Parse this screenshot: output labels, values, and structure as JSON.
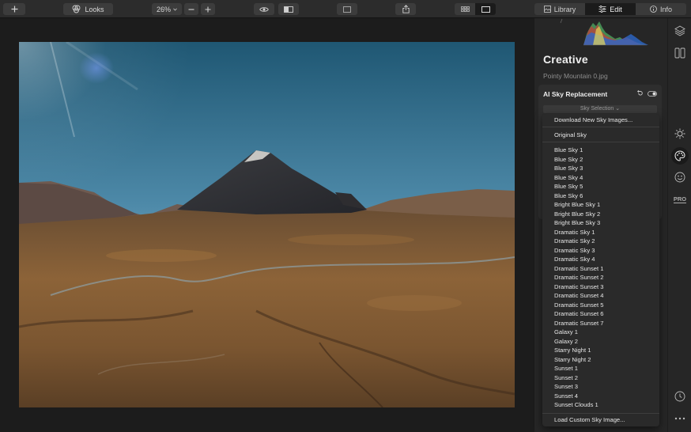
{
  "toolbar": {
    "looks_label": "Looks",
    "zoom_value": "26%",
    "tabs": [
      {
        "label": "Library",
        "active": false
      },
      {
        "label": "Edit",
        "active": true
      },
      {
        "label": "Info",
        "active": false
      }
    ]
  },
  "panel": {
    "title": "Creative",
    "filename": "Pointy Mountain 0.jpg",
    "filter_name": "AI Sky Replacement",
    "sky_selection_label": "Sky Selection"
  },
  "dropdown": {
    "download_label": "Download New Sky Images...",
    "original_label": "Original Sky",
    "skies": [
      "Blue Sky 1",
      "Blue Sky 2",
      "Blue Sky 3",
      "Blue Sky 4",
      "Blue Sky 5",
      "Blue Sky 6",
      "Bright Blue Sky 1",
      "Bright Blue Sky 2",
      "Bright Blue Sky 3",
      "Dramatic Sky 1",
      "Dramatic Sky 2",
      "Dramatic Sky 3",
      "Dramatic Sky 4",
      "Dramatic Sunset 1",
      "Dramatic Sunset 2",
      "Dramatic Sunset 3",
      "Dramatic Sunset 4",
      "Dramatic Sunset 5",
      "Dramatic Sunset 6",
      "Dramatic Sunset 7",
      "Galaxy 1",
      "Galaxy 2",
      "Starry Night 1",
      "Starry Night 2",
      "Sunset 1",
      "Sunset 2",
      "Sunset 3",
      "Sunset 4",
      "Sunset Clouds 1"
    ],
    "load_custom_label": "Load Custom Sky Image..."
  },
  "rail": {
    "icons": [
      "layers-icon",
      "compare-panels-icon",
      "sun-icon",
      "palette-icon",
      "face-icon",
      "pro-icon",
      "history-icon",
      "more-icon"
    ],
    "pro_label": "PRO"
  },
  "colors": {
    "accent_selected": "#1b1b1b",
    "panel_bg": "#262626",
    "dropdown_bg": "#2a2a2a"
  }
}
